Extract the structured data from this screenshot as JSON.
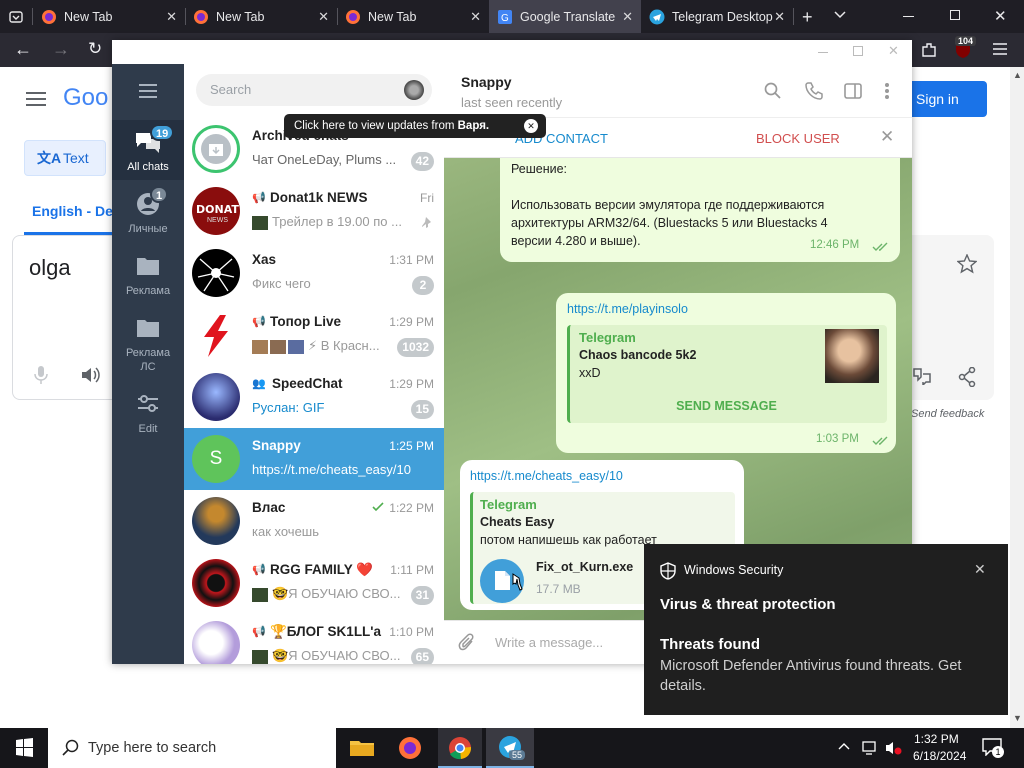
{
  "browser": {
    "tabs": [
      {
        "label": "New Tab",
        "icon": "firefox-icon"
      },
      {
        "label": "New Tab",
        "icon": "firefox-icon"
      },
      {
        "label": "New Tab",
        "icon": "firefox-icon"
      },
      {
        "label": "Google Translate",
        "icon": "google-translate-icon",
        "active": true
      },
      {
        "label": "Telegram Desktop",
        "icon": "telegram-icon"
      }
    ],
    "extension_badge": "104"
  },
  "translate": {
    "logo_text": "Goo",
    "text_button": "Text",
    "source_lang": "English - Det",
    "input_text": "olga",
    "sign_in": "Sign in",
    "send_feedback": "Send feedback"
  },
  "telegram": {
    "sidebar": [
      {
        "label": "All chats",
        "badge": "19",
        "icon": "chats-icon",
        "active": true
      },
      {
        "label": "Личные",
        "badge": "1",
        "icon": "person-icon"
      },
      {
        "label": "Реклама",
        "icon": "folder-icon"
      },
      {
        "label": "Реклама ЛС",
        "icon": "folder-icon"
      },
      {
        "label": "Edit",
        "icon": "sliders-icon"
      }
    ],
    "search_placeholder": "Search",
    "tooltip_prefix": "Click here to view updates from ",
    "tooltip_name": "Варя.",
    "chats": [
      {
        "name": "Archived chats",
        "time": "",
        "preview": "Чат OneLeDay, Plums ...",
        "count": "42"
      },
      {
        "name": "Donat1k NEWS",
        "time": "Fri",
        "preview": "Трейлер в 19.00 по ...",
        "count": ""
      },
      {
        "name": "Xas",
        "time": "1:31 PM",
        "preview": "Фикс чего",
        "count": "2"
      },
      {
        "name": "Топор Live",
        "time": "1:29 PM",
        "preview": "⚡ В Красн...",
        "count": "1032"
      },
      {
        "name": "SpeedChat",
        "time": "1:29 PM",
        "preview": "Руслан: GIF",
        "count": "15"
      },
      {
        "name": "Snappy",
        "time": "1:25 PM",
        "preview": "https://t.me/cheats_easy/10",
        "count": "",
        "avatar_letter": "S"
      },
      {
        "name": "Влас",
        "time": "1:22 PM",
        "preview": "как хочешь",
        "count": ""
      },
      {
        "name": "RGG FAMILY ❤️",
        "time": "1:11 PM",
        "preview": "🤓Я ОБУЧАЮ СВО...",
        "count": "31"
      },
      {
        "name": "🏆БЛОГ SK1LL'а",
        "time": "1:10 PM",
        "preview": "🤓Я ОБУЧАЮ СВО...",
        "count": "65"
      }
    ],
    "header": {
      "name": "Snappy",
      "status": "last seen recently"
    },
    "add_contact": "ADD CONTACT",
    "block_user": "BLOCK USER",
    "msg1": {
      "line1": "Решение:",
      "line2": "Использовать версии эмулятора где поддерживаются",
      "line3": "архитектуры ARM32/64. (Bluestacks 5 или Bluestacks 4",
      "line4": "версии 4.280 и выше).",
      "time": "12:46 PM"
    },
    "msg2": {
      "link": "https://t.me/playinsolo",
      "site": "Telegram",
      "title": "Chaos bancode 5k2",
      "desc": "xxD",
      "action": "SEND MESSAGE",
      "time": "1:03 PM"
    },
    "msg3": {
      "link": "https://t.me/cheats_easy/10",
      "site": "Telegram",
      "title": "Cheats Easy",
      "desc": "потом напишешь как работает",
      "file_name": "Fix_ot_Kurn.exe",
      "file_size": "17.7 MB"
    },
    "compose_placeholder": "Write a message..."
  },
  "toast": {
    "app": "Windows Security",
    "heading": "Virus & threat protection",
    "title": "Threats found",
    "body": "Microsoft Defender Antivirus found threats. Get details."
  },
  "taskbar": {
    "search_placeholder": "Type here to search",
    "telegram_badge": "55",
    "time": "1:32 PM",
    "date": "6/18/2024",
    "notif_count": "1"
  }
}
